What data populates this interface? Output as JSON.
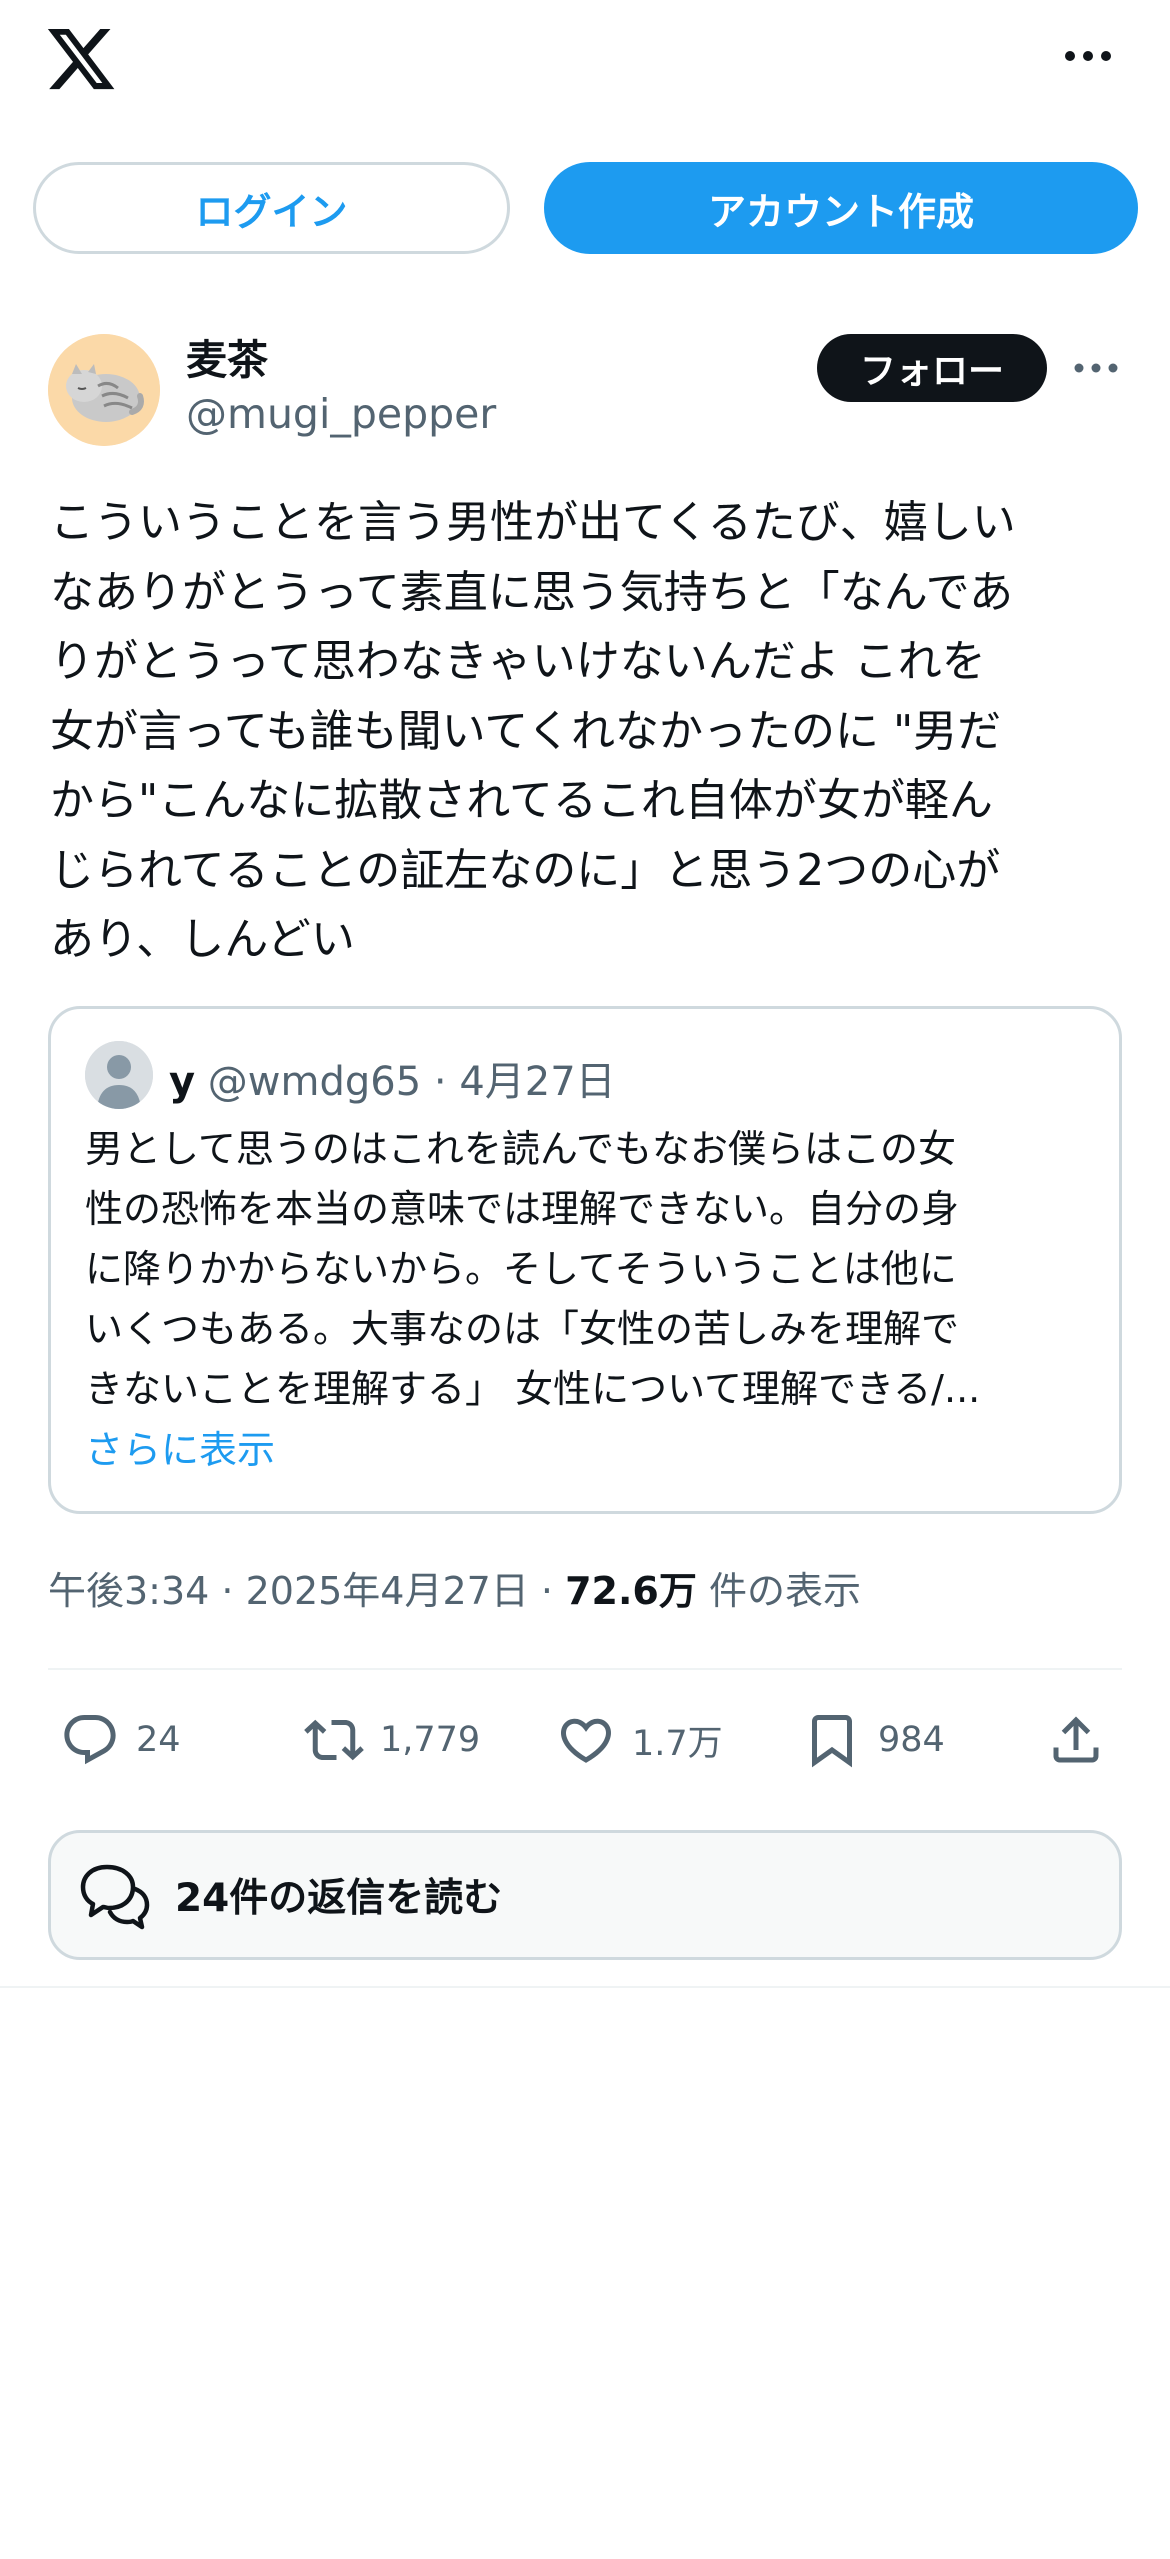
{
  "topbar": {
    "logo_icon": "x-logo-icon",
    "more_icon": "more-horizontal-icon"
  },
  "auth": {
    "login_label": "ログイン",
    "signup_label": "アカウント作成"
  },
  "author": {
    "name": "麦茶",
    "handle": "@mugi_pepper",
    "follow_label": "フォロー",
    "avatar_icon": "cat-avatar"
  },
  "tweet": {
    "text": "こういうことを言う男性が出てくるたび、嬉しい\nなありがとうって素直に思う気持ちと「なんであ\nりがとうって思わなきゃいけないんだよ  これを\n女が言っても誰も聞いてくれなかったのに \"男だ\nから\"こんなに拡散されてるこれ自体が女が軽ん\nじられてることの証左なのに」と思う2つの心が\nあり、しんどい"
  },
  "quote": {
    "name": "y",
    "handle": "@wmdg65",
    "separator": " · ",
    "date": "4月27日",
    "text": "男として思うのはこれを読んでもなお僕らはこの女\n性の恐怖を本当の意味では理解できない。自分の身\nに降りかからないから。そしてそういうことは他に\nいくつもある。大事なのは「女性の苦しみを理解で\nきないことを理解する」 女性について理解できる/...",
    "show_more": "さらに表示"
  },
  "timestamp": {
    "time": "午後3:34",
    "sep1": " · ",
    "date": "2025年4月27日",
    "sep2": " · ",
    "views": "72.6万",
    "views_label": " 件の表示"
  },
  "actions": {
    "replies": "24",
    "retweets": "1,779",
    "likes": "1.7万",
    "bookmarks": "984"
  },
  "read_replies": {
    "label": "24件の返信を読む"
  },
  "colors": {
    "accent": "#1d9bf0",
    "text": "#0f1419",
    "muted": "#536471",
    "border": "#cfd9de"
  }
}
